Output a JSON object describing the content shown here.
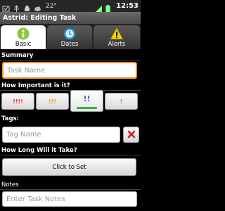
{
  "status_bar": {
    "temperature": "22°",
    "time": "12:53"
  },
  "title": "Astrid: Editing Task",
  "tabs": [
    {
      "label": "Basic",
      "icon": "info-icon",
      "active": true
    },
    {
      "label": "Dates",
      "icon": "clock-icon",
      "active": false
    },
    {
      "label": "Alerts",
      "icon": "warning-icon",
      "active": false
    }
  ],
  "summary": {
    "label": "Summary",
    "placeholder": "Task Name"
  },
  "importance": {
    "label": "How Important is it?",
    "options": [
      {
        "text": "!!!!",
        "color": "#e53333",
        "selected": false
      },
      {
        "text": "!!!",
        "color": "#f39c12",
        "selected": false
      },
      {
        "text": "!!",
        "color": "#2e6fc7",
        "selected": true
      },
      {
        "text": "!",
        "color": "#999999",
        "selected": false
      }
    ]
  },
  "tags": {
    "label": "Tags:",
    "placeholder": "Tag Name"
  },
  "duration": {
    "label": "How Long Will it Take?",
    "button": "Click to Set"
  },
  "notes": {
    "label": "Notes",
    "placeholder": "Enter Task Notes"
  },
  "colors": {
    "focus": "#f7931e",
    "accent_green": "#3bb33b",
    "delete_red": "#d0231f"
  }
}
